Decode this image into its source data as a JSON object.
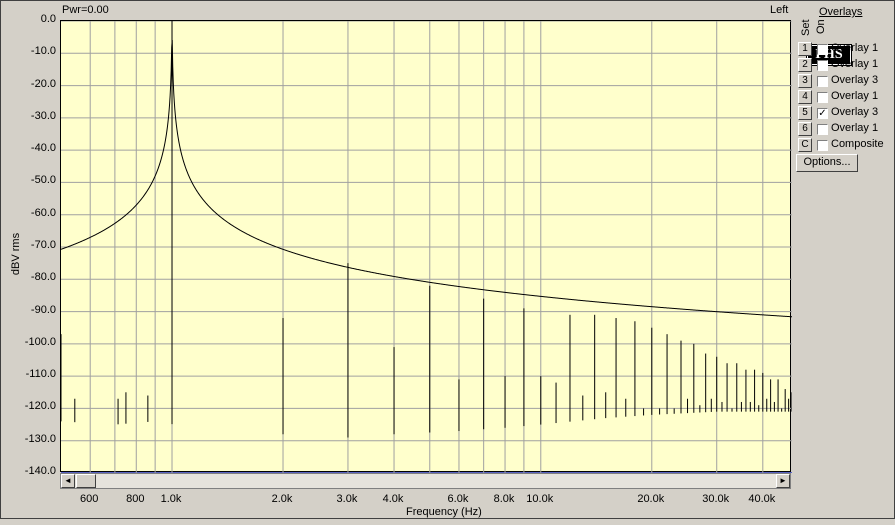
{
  "header": {
    "power_label": "Pwr=0.00",
    "channel_label": "Left"
  },
  "logo": {
    "text": "PHS"
  },
  "overlays_panel": {
    "title": "Overlays",
    "set_header": "Set",
    "on_header": "On",
    "rows": [
      {
        "set": "1",
        "checked": false,
        "label": "Overlay 1"
      },
      {
        "set": "2",
        "checked": false,
        "label": "Overlay 1"
      },
      {
        "set": "3",
        "checked": false,
        "label": "Overlay 3"
      },
      {
        "set": "4",
        "checked": false,
        "label": "Overlay 1"
      },
      {
        "set": "5",
        "checked": true,
        "label": "Overlay 3"
      },
      {
        "set": "6",
        "checked": false,
        "label": "Overlay 1"
      },
      {
        "set": "C",
        "checked": false,
        "label": "Composite"
      }
    ],
    "options_button": "Options...",
    "check_glyph": "✓"
  },
  "scrollbar": {
    "left_arrow": "◄",
    "right_arrow": "►"
  },
  "colors": {
    "plot_bg": "#ffffcc",
    "grid": "#a0a0a0",
    "trace": "#000000",
    "baseline": "#3040c0",
    "window_bg": "#d4d0c8"
  },
  "chart_data": {
    "type": "line",
    "xlabel": "Frequency (Hz)",
    "ylabel": "dBV rms",
    "x_scale": "log",
    "xlim": [
      500,
      48000
    ],
    "ylim": [
      -140,
      0
    ],
    "y_ticks": [
      0,
      -10,
      -20,
      -30,
      -40,
      -50,
      -60,
      -70,
      -80,
      -90,
      -100,
      -110,
      -120,
      -130,
      -140
    ],
    "y_tick_labels": [
      "0.0",
      "-10.0",
      "-20.0",
      "-30.0",
      "-40.0",
      "-50.0",
      "-60.0",
      "-70.0",
      "-80.0",
      "-90.0",
      "-100.0",
      "-110.0",
      "-120.0",
      "-130.0",
      "-140.0"
    ],
    "x_ticks": [
      600,
      800,
      1000,
      2000,
      3000,
      4000,
      6000,
      8000,
      10000,
      20000,
      30000,
      40000
    ],
    "x_tick_labels": [
      "600",
      "800",
      "1.0k",
      "2.0k",
      "3.0k",
      "4.0k",
      "6.0k",
      "8.0k",
      "10.0k",
      "20.0k",
      "30.0k",
      "40.0k"
    ],
    "grid": true,
    "noise_floor": [
      [
        500,
        -124
      ],
      [
        700,
        -125
      ],
      [
        900,
        -124
      ],
      [
        1300,
        -127
      ],
      [
        2000,
        -128
      ],
      [
        2500,
        -129
      ],
      [
        3000,
        -129
      ],
      [
        4000,
        -128
      ],
      [
        6000,
        -127
      ],
      [
        8000,
        -126
      ],
      [
        10000,
        -125
      ],
      [
        15000,
        -123
      ],
      [
        20000,
        -122
      ],
      [
        30000,
        -121
      ],
      [
        48000,
        -121
      ]
    ],
    "peaks": [
      [
        500,
        -97
      ],
      [
        545,
        -117
      ],
      [
        714,
        -117
      ],
      [
        750,
        -115
      ],
      [
        860,
        -116
      ],
      [
        1000,
        0
      ],
      [
        2000,
        -92
      ],
      [
        3000,
        -75
      ],
      [
        4000,
        -101
      ],
      [
        5000,
        -82
      ],
      [
        6000,
        -111
      ],
      [
        7000,
        -86
      ],
      [
        8000,
        -110
      ],
      [
        9000,
        -89
      ],
      [
        10000,
        -110
      ],
      [
        11000,
        -112
      ],
      [
        12000,
        -91
      ],
      [
        13000,
        -116
      ],
      [
        14000,
        -91
      ],
      [
        15000,
        -115
      ],
      [
        16000,
        -92
      ],
      [
        17000,
        -117
      ],
      [
        18000,
        -93
      ],
      [
        19000,
        -120
      ],
      [
        20000,
        -95
      ],
      [
        21000,
        -120
      ],
      [
        22000,
        -97
      ],
      [
        23000,
        -120
      ],
      [
        24000,
        -99
      ],
      [
        25000,
        -117
      ],
      [
        26000,
        -100
      ],
      [
        27000,
        -119
      ],
      [
        28000,
        -103
      ],
      [
        29000,
        -117
      ],
      [
        30000,
        -104
      ],
      [
        31000,
        -118
      ],
      [
        32000,
        -106
      ],
      [
        33000,
        -120
      ],
      [
        34000,
        -106
      ],
      [
        35000,
        -118
      ],
      [
        36000,
        -108
      ],
      [
        37000,
        -118
      ],
      [
        38000,
        -108
      ],
      [
        39000,
        -119
      ],
      [
        40000,
        -109
      ],
      [
        41000,
        -117
      ],
      [
        42000,
        -111
      ],
      [
        43000,
        -118
      ],
      [
        44000,
        -111
      ],
      [
        45000,
        -120
      ],
      [
        46000,
        -114
      ],
      [
        47000,
        -117
      ],
      [
        48000,
        -115
      ]
    ]
  }
}
